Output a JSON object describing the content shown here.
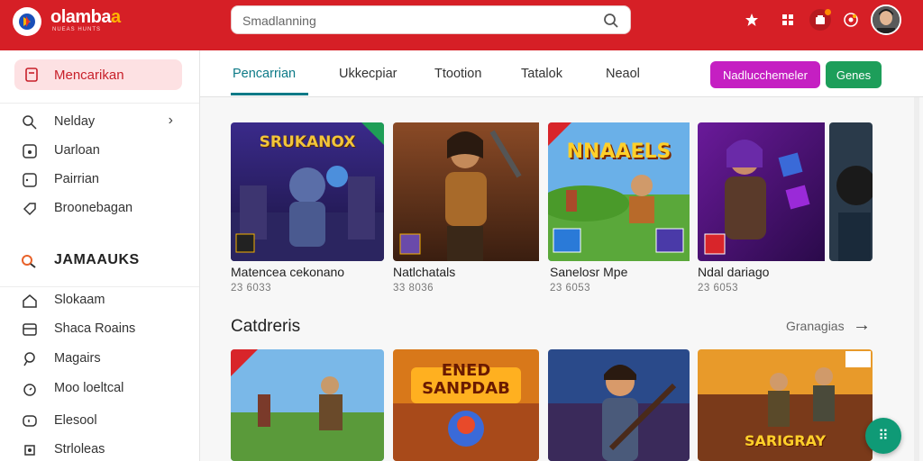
{
  "app": {
    "brand": "olamba",
    "brand_accent": "a",
    "brand_sub": "NUEAS HUNTS",
    "accent_color": "#d61f26"
  },
  "search": {
    "value": "Smadlanning",
    "icon": "search-icon"
  },
  "top_icons": [
    "star-icon",
    "grid-icon",
    "notification-icon",
    "settings-icon"
  ],
  "sidebar": {
    "active": {
      "label": "Mencarikan",
      "icon": "bookmark-icon"
    },
    "items": [
      {
        "label": "Nelday",
        "icon": "search-person-icon",
        "chevron": "›"
      },
      {
        "label": "Uarloan",
        "icon": "clock-icon"
      },
      {
        "label": "Pairrian",
        "icon": "square-icon"
      },
      {
        "label": "Broonebagan",
        "icon": "tag-icon"
      }
    ],
    "section": {
      "label": "JAMAAUKS",
      "icon": "search-orange-icon"
    },
    "section_items": [
      {
        "label": "Slokaam",
        "icon": "home-icon"
      },
      {
        "label": "Shaca Roains",
        "icon": "list-icon"
      },
      {
        "label": "Magairs",
        "icon": "pin-icon"
      },
      {
        "label": "Moo loeltcal",
        "icon": "timer-icon"
      },
      {
        "label": "Elesool",
        "icon": "chat-icon"
      },
      {
        "label": "Strloleas",
        "icon": "gear-icon"
      }
    ]
  },
  "tabs": [
    {
      "label": "Pencarrian",
      "active": true
    },
    {
      "label": "Ukkecpiar",
      "active": false
    },
    {
      "label": "Ttootion",
      "active": false
    },
    {
      "label": "Tatalok",
      "active": false
    },
    {
      "label": "Neaol",
      "active": false
    }
  ],
  "buttons": {
    "primary": "Nadlucchemeler",
    "secondary": "Genes",
    "primary_color": "#c51fc2",
    "secondary_color": "#1d9e5a"
  },
  "row1": [
    {
      "title": "Matencea cekonano",
      "meta": "23 6033",
      "art": "SRUKANOX"
    },
    {
      "title": "Natlchatals",
      "meta": "33 8036",
      "art": ""
    },
    {
      "title": "Sanelosr Mpe",
      "meta": "23 6053",
      "art": "NNAAELS"
    },
    {
      "title": "Ndal dariago",
      "meta": "23 6053",
      "art": ""
    }
  ],
  "section2": {
    "title": "Catdreris",
    "see_all": "Granagias",
    "arrow": "→"
  },
  "row2": [
    {
      "art": ""
    },
    {
      "art": "ENED SANPDAB"
    },
    {
      "art": ""
    },
    {
      "art": "SARIGRAY"
    }
  ],
  "fab": {
    "icon": "apps-icon",
    "glyph": "⠿"
  }
}
